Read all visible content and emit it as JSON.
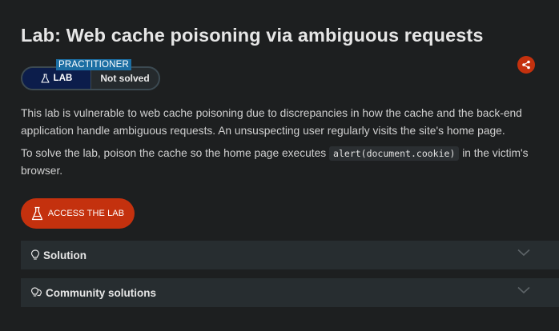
{
  "page": {
    "title": "Lab: Web cache poisoning via ambiguous requests"
  },
  "level": {
    "tag": "PRACTITIONER",
    "lab_label": "LAB",
    "status": "Not solved"
  },
  "description": {
    "paragraph1": "This lab is vulnerable to web cache poisoning due to discrepancies in how the cache and the back-end application handle ambiguous requests. An unsuspecting user regularly visits the site's home page.",
    "paragraph2_before": "To solve the lab, poison the cache so the home page executes ",
    "paragraph2_code": "alert(document.cookie)",
    "paragraph2_after": " in the victim's browser."
  },
  "actions": {
    "access_lab": "ACCESS THE LAB"
  },
  "accordions": [
    {
      "label": "Solution",
      "icon": "lightbulb-icon"
    },
    {
      "label": "Community solutions",
      "icon": "lightbulbs-icon"
    }
  ],
  "colors": {
    "background": "#1d1f20",
    "accent": "#c4310e",
    "tag_blue": "#1c6ea3",
    "lab_navy": "#0c1d4b",
    "panel": "#272d30"
  },
  "icons": {
    "share": "share-icon",
    "flask": "flask-icon",
    "chevron": "chevron-down-icon"
  }
}
